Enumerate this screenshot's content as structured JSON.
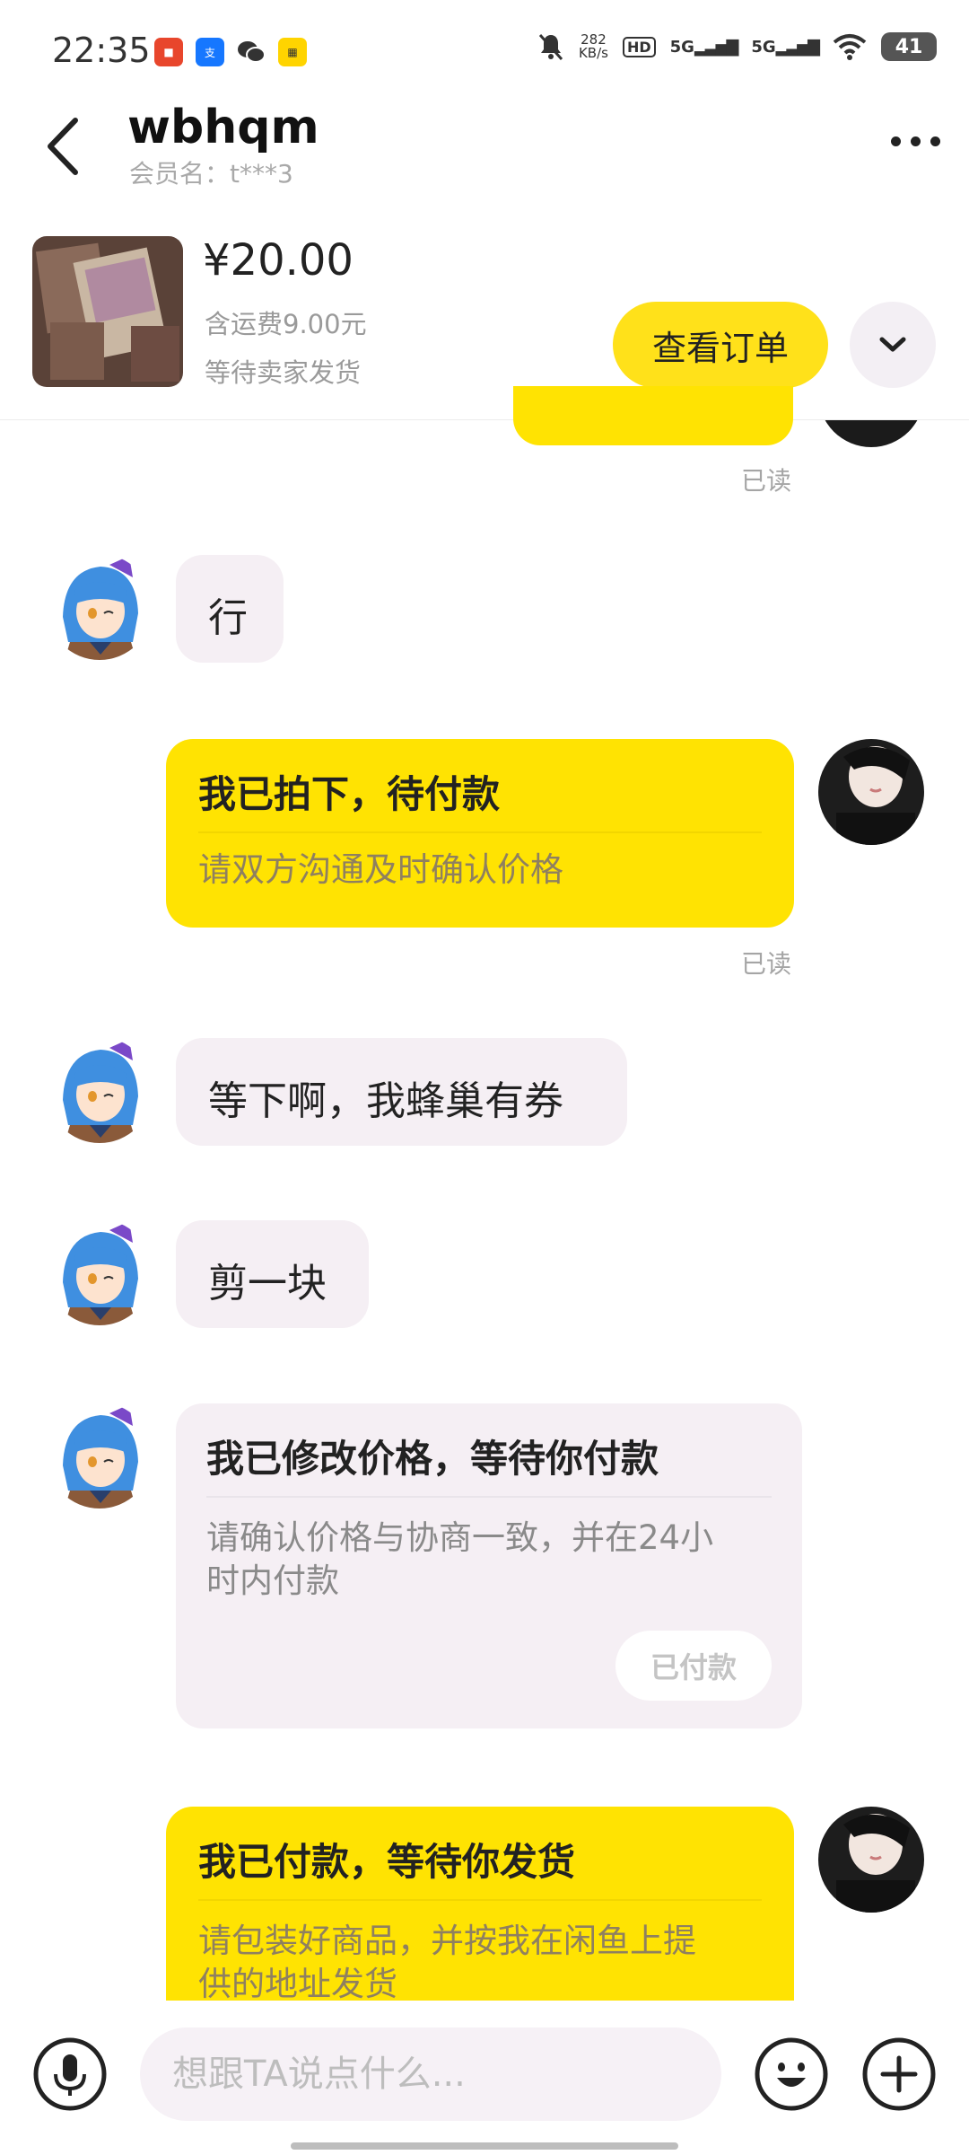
{
  "status_bar": {
    "time": "22:35",
    "net_speed_value": "282",
    "net_speed_unit": "KB/s",
    "hd_label": "HD",
    "signal1": "5G",
    "signal2": "5G",
    "battery": "41",
    "app_icons": [
      "pingan-bank-icon",
      "alipay-icon",
      "wechat-icon",
      "ticket-app-icon"
    ]
  },
  "header": {
    "title": "wbhqm",
    "subtitle": "会员名：t***3"
  },
  "product": {
    "price": "¥20.00",
    "shipping": "含运费9.00元",
    "status": "等待卖家发货",
    "view_order_label": "查看订单"
  },
  "messages": [
    {
      "from": "other",
      "text": "行"
    },
    {
      "from": "me",
      "title": "我已拍下，待付款",
      "desc": "请双方沟通及时确认价格",
      "read": "已读"
    },
    {
      "from": "other",
      "text": "等下啊，我蜂巢有券"
    },
    {
      "from": "other",
      "text": "剪一块"
    },
    {
      "from": "other",
      "title": "我已修改价格，等待你付款",
      "desc_line1": "请确认价格与协商一致，并在24小",
      "desc_line2": "时内付款",
      "button": "已付款"
    },
    {
      "from": "me",
      "title": "我已付款，等待你发货",
      "desc_line1": "请包装好商品，并按我在闲鱼上提",
      "desc_line2": "供的地址发货"
    }
  ],
  "top_read_label": "已读",
  "input": {
    "placeholder": "想跟TA说点什么..."
  },
  "colors": {
    "accent_yellow": "#ffe302",
    "other_bubble": "#f5eff4"
  }
}
